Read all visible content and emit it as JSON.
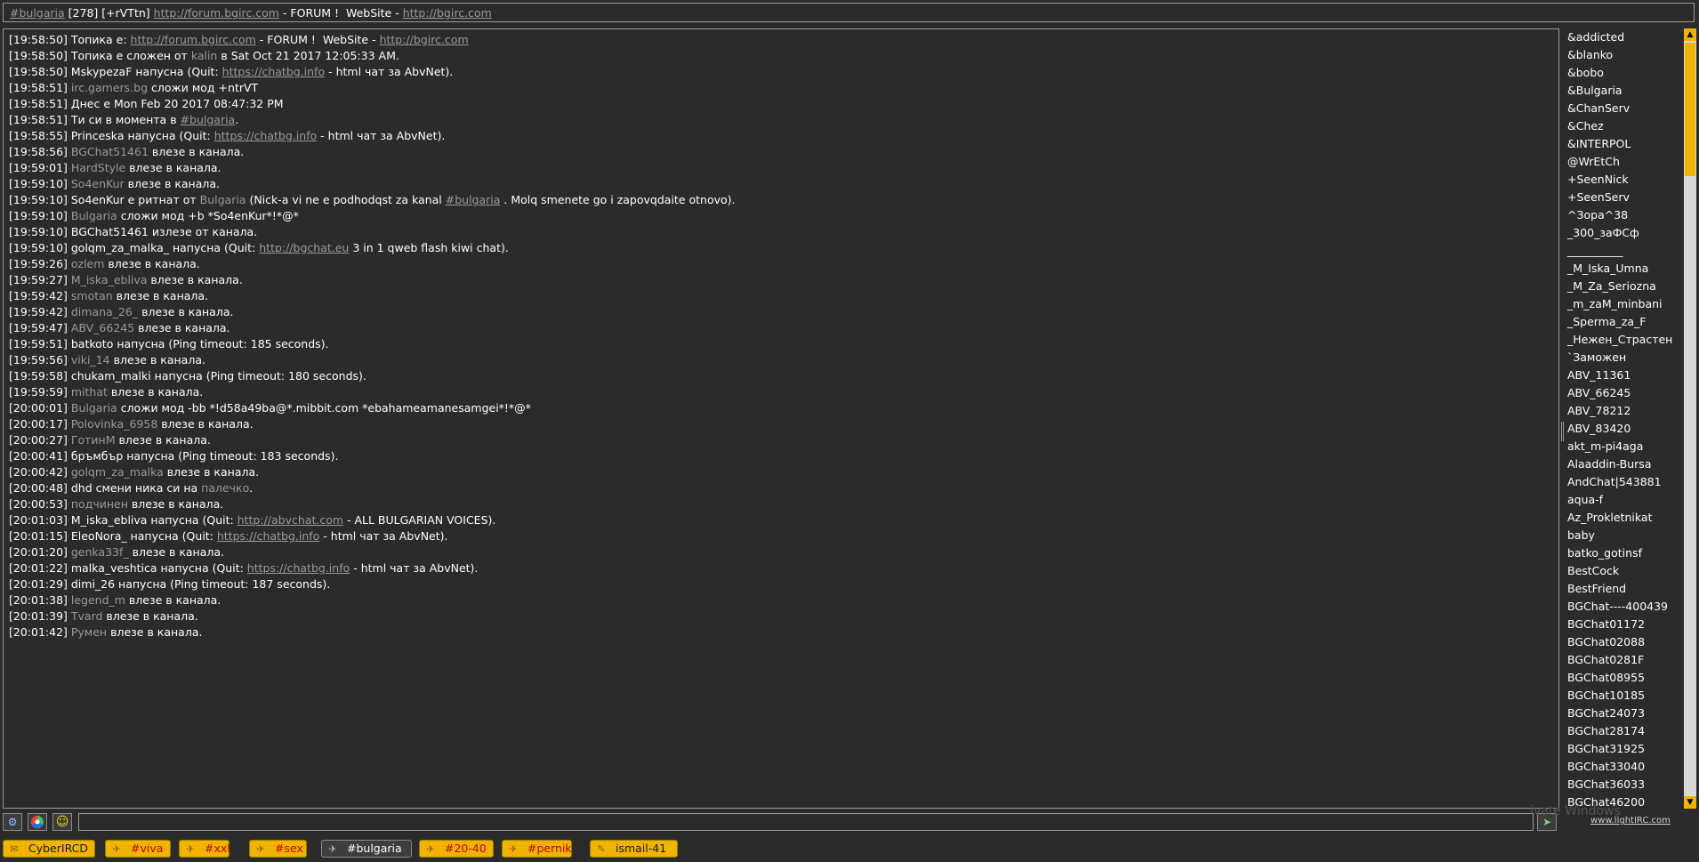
{
  "topic": {
    "channel": "#bulgaria",
    "count": "[278]",
    "modes": "[+rVTtn]",
    "forum_url": "http://forum.bgirc.com",
    "middle": " - FORUM !  WebSite - ",
    "site_url": "http://bgirc.com"
  },
  "messages": [
    [
      {
        "t": "[19:58:50] Топика е: "
      },
      {
        "t": "http://forum.bgirc.com",
        "c": "link"
      },
      {
        "t": " - FORUM !  WebSite - "
      },
      {
        "t": "http://bgirc.com",
        "c": "link"
      }
    ],
    [
      {
        "t": "[19:58:50] Топика е сложен от "
      },
      {
        "t": "kalin",
        "c": "nick"
      },
      {
        "t": " в Sat Oct 21 2017 12:05:33 AM."
      }
    ],
    [
      {
        "t": "[19:58:50] MskypezaF напусна (Quit: "
      },
      {
        "t": "https://chatbg.info",
        "c": "link"
      },
      {
        "t": " - html чат за AbvNet)."
      }
    ],
    [
      {
        "t": "[19:58:51] "
      },
      {
        "t": "irc.gamers.bg",
        "c": "nick"
      },
      {
        "t": " сложи мод +ntrVT"
      }
    ],
    [
      {
        "t": "[19:58:51] Днес е Mon Feb 20 2017 08:47:32 PM"
      }
    ],
    [
      {
        "t": "[19:58:51] Ти си в момента в "
      },
      {
        "t": "#bulgaria",
        "c": "link"
      },
      {
        "t": "."
      }
    ],
    [
      {
        "t": "[19:58:55] Princeska напусна (Quit: "
      },
      {
        "t": "https://chatbg.info",
        "c": "link"
      },
      {
        "t": " - html чат за AbvNet)."
      }
    ],
    [
      {
        "t": "[19:58:56] "
      },
      {
        "t": "BGChat51461",
        "c": "nick"
      },
      {
        "t": " влезе в канала."
      }
    ],
    [
      {
        "t": "[19:59:01] "
      },
      {
        "t": "HardStyle",
        "c": "nick"
      },
      {
        "t": " влезе в канала."
      }
    ],
    [
      {
        "t": "[19:59:10] "
      },
      {
        "t": "So4enKur",
        "c": "nick"
      },
      {
        "t": " влезе в канала."
      }
    ],
    [
      {
        "t": "[19:59:10] So4enKur е ритнат от "
      },
      {
        "t": "Bulgaria",
        "c": "nick"
      },
      {
        "t": " (Nick-a vi ne e podhodqst za kanal "
      },
      {
        "t": "#bulgaria",
        "c": "link"
      },
      {
        "t": " . Molq smenete go i zapovqdaite otnovo)."
      }
    ],
    [
      {
        "t": "[19:59:10] "
      },
      {
        "t": "Bulgaria",
        "c": "nick"
      },
      {
        "t": " сложи мод +b *So4enKur*!*@*"
      }
    ],
    [
      {
        "t": "[19:59:10] BGChat51461 излезе от канала."
      }
    ],
    [
      {
        "t": "[19:59:10] golqm_za_malka_ напусна (Quit: "
      },
      {
        "t": "http://bgchat.eu",
        "c": "link"
      },
      {
        "t": " 3 in 1 qweb flash kiwi chat)."
      }
    ],
    [
      {
        "t": "[19:59:26] "
      },
      {
        "t": "ozlem",
        "c": "nick"
      },
      {
        "t": " влезе в канала."
      }
    ],
    [
      {
        "t": "[19:59:27] "
      },
      {
        "t": "M_iska_ebliva",
        "c": "nick"
      },
      {
        "t": " влезе в канала."
      }
    ],
    [
      {
        "t": "[19:59:42] "
      },
      {
        "t": "smotan",
        "c": "nick"
      },
      {
        "t": " влезе в канала."
      }
    ],
    [
      {
        "t": "[19:59:42] "
      },
      {
        "t": "dimana_26_",
        "c": "nick"
      },
      {
        "t": " влезе в канала."
      }
    ],
    [
      {
        "t": "[19:59:47] "
      },
      {
        "t": "ABV_66245",
        "c": "nick"
      },
      {
        "t": " влезе в канала."
      }
    ],
    [
      {
        "t": "[19:59:51] batkoto напусна (Ping timeout: 185 seconds)."
      }
    ],
    [
      {
        "t": "[19:59:56] "
      },
      {
        "t": "viki_14",
        "c": "nick"
      },
      {
        "t": " влезе в канала."
      }
    ],
    [
      {
        "t": "[19:59:58] chukam_malki напусна (Ping timeout: 180 seconds)."
      }
    ],
    [
      {
        "t": "[19:59:59] "
      },
      {
        "t": "mithat",
        "c": "nick"
      },
      {
        "t": " влезе в канала."
      }
    ],
    [
      {
        "t": "[20:00:01] "
      },
      {
        "t": "Bulgaria",
        "c": "nick"
      },
      {
        "t": " сложи мод -bb *!d58a49ba@*.mibbit.com *ebahameamanesamgei*!*@*"
      }
    ],
    [
      {
        "t": "[20:00:17] "
      },
      {
        "t": "Polovinka_6958",
        "c": "nick"
      },
      {
        "t": " влезе в канала."
      }
    ],
    [
      {
        "t": "[20:00:27] "
      },
      {
        "t": "ГотинМ",
        "c": "nick"
      },
      {
        "t": " влезе в канала."
      }
    ],
    [
      {
        "t": "[20:00:41] бръмбър напусна (Ping timeout: 183 seconds)."
      }
    ],
    [
      {
        "t": "[20:00:42] "
      },
      {
        "t": "golqm_za_malka",
        "c": "nick"
      },
      {
        "t": " влезе в канала."
      }
    ],
    [
      {
        "t": "[20:00:48] dhd смени ника си на "
      },
      {
        "t": "палечко",
        "c": "nick"
      },
      {
        "t": "."
      }
    ],
    [
      {
        "t": "[20:00:53] "
      },
      {
        "t": "подчинен",
        "c": "nick"
      },
      {
        "t": " влезе в канала."
      }
    ],
    [
      {
        "t": "[20:01:03] M_iska_ebliva напусна (Quit: "
      },
      {
        "t": "http://abvchat.com",
        "c": "link"
      },
      {
        "t": " - ALL BULGARIAN VOICES)."
      }
    ],
    [
      {
        "t": "[20:01:15] EleoNora_ напусна (Quit: "
      },
      {
        "t": "https://chatbg.info",
        "c": "link"
      },
      {
        "t": " - html чат за AbvNet)."
      }
    ],
    [
      {
        "t": "[20:01:20] "
      },
      {
        "t": "genka33f_",
        "c": "nick"
      },
      {
        "t": " влезе в канала."
      }
    ],
    [
      {
        "t": "[20:01:22] malka_veshtica напусна (Quit: "
      },
      {
        "t": "https://chatbg.info",
        "c": "link"
      },
      {
        "t": " - html чат за AbvNet)."
      }
    ],
    [
      {
        "t": "[20:01:29] dimi_26 напусна (Ping timeout: 187 seconds)."
      }
    ],
    [
      {
        "t": "[20:01:38] "
      },
      {
        "t": "legend_m",
        "c": "nick"
      },
      {
        "t": " влезе в канала."
      }
    ],
    [
      {
        "t": "[20:01:39] "
      },
      {
        "t": "Tvard",
        "c": "nick"
      },
      {
        "t": " влезе в канала."
      }
    ],
    [
      {
        "t": "[20:01:42] "
      },
      {
        "t": "Румен",
        "c": "nick"
      },
      {
        "t": " влезе в канала."
      }
    ]
  ],
  "nicks": [
    "&addicted",
    "&blanko",
    "&bobo",
    "&Bulgaria",
    "&ChanServ",
    "&Chez",
    "&INTERPOL",
    "@WrEtCh",
    "+SeenNick",
    "+SeenServ",
    "^Зора^38",
    "_300_заФСф",
    "__________",
    "_M_Iska_Umna",
    "_M_Za_Seriozna",
    "_m_zaM_minbani",
    "_Sperma_za_F",
    "_Нежен_Страстен",
    "`Заможен",
    "ABV_11361",
    "ABV_66245",
    "ABV_78212",
    "ABV_83420",
    "akt_m-pi4aga",
    "Alaaddin-Bursa",
    "AndChat|543881",
    "aqua-f",
    "Az_Prokletnikat",
    "baby",
    "batko_gotinsf",
    "BestCock",
    "BestFriend",
    "BGChat----400439",
    "BGChat01172",
    "BGChat02088",
    "BGChat0281F",
    "BGChat08955",
    "BGChat10185",
    "BGChat24073",
    "BGChat28174",
    "BGChat31925",
    "BGChat33040",
    "BGChat36033",
    "BGChat46200"
  ],
  "input": {
    "value": ""
  },
  "watermark": "ivate Windows",
  "footer_link": "www.lightIRC.com",
  "icons": {
    "left_buttons": [
      "settings-icon",
      "color-wheel-icon",
      "smiley-icon"
    ],
    "send": "send-icon"
  },
  "tabs": [
    {
      "label": "CyberIRCD",
      "icon": "server-icon",
      "active": false
    },
    {
      "label": "#viva",
      "icon": "channel-icon",
      "active": false
    },
    {
      "label": "#xxl",
      "icon": "channel-icon",
      "active": false
    },
    {
      "label": "#sex",
      "icon": "channel-icon",
      "active": false
    },
    {
      "label": "#bulgaria",
      "icon": "channel-icon",
      "active": true
    },
    {
      "label": "#20-40",
      "icon": "channel-icon",
      "active": false
    },
    {
      "label": "#pernik",
      "icon": "channel-icon",
      "active": false
    },
    {
      "label": "ismail-41",
      "icon": "query-icon",
      "active": false
    }
  ],
  "colors": {
    "background": "#2b2b2b",
    "accent": "#f0b400",
    "tab_text": "#c00000",
    "link": "#9a9a9a"
  }
}
